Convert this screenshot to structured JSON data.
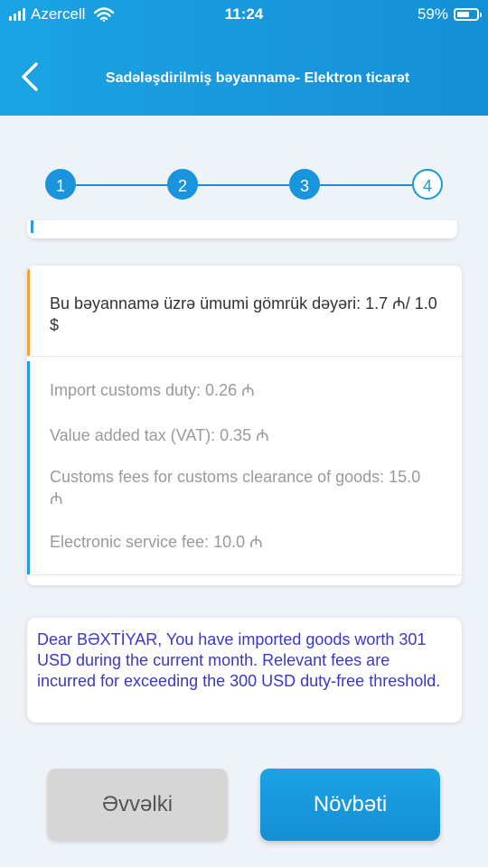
{
  "status_bar": {
    "carrier": "Azercell",
    "time": "11:24",
    "battery": "59%",
    "battery_level": 0.59
  },
  "header": {
    "title": "Sadələşdirilmiş bəyannamə- Elektron ticarət",
    "back_icon": "chevron-left-icon"
  },
  "stepper": {
    "steps": [
      "1",
      "2",
      "3",
      "4"
    ],
    "active_step": 4
  },
  "summary": {
    "total_text": "Bu bəyannamə üzrə ümumi gömrük dəyəri: 1.7 ₼/ 1.0 $",
    "items": [
      "Import customs duty:  0.26 ₼",
      "Value added tax (VAT):  0.35 ₼",
      "Customs fees for customs clearance of goods:  15.0 ₼",
      "Electronic service fee:  10.0 ₼"
    ]
  },
  "notice": {
    "text": "Dear BƏXTİYAR, You have imported goods worth 301 USD during the current month. Relevant fees are incurred for exceeding the 300 USD duty-free threshold."
  },
  "buttons": {
    "prev_label": "Əvvəlki",
    "next_label": "Növbəti"
  },
  "colors": {
    "accent": "#1a95dd",
    "total_accent": "#f2a23b",
    "notice_text": "#3b38c9"
  }
}
